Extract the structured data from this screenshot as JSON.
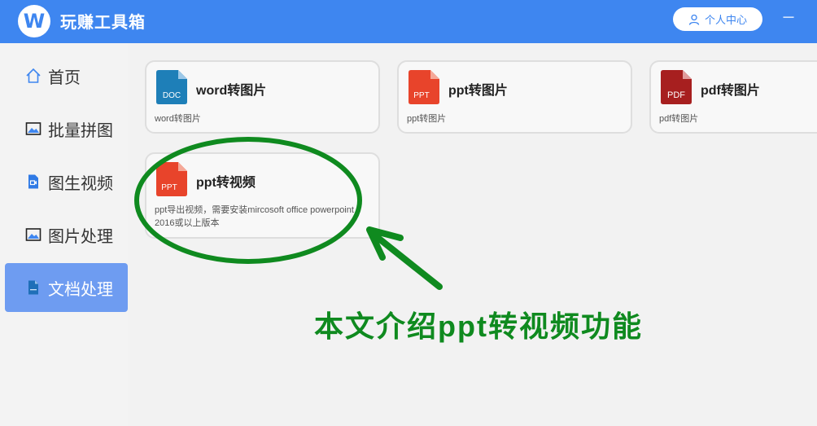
{
  "app": {
    "title": "玩赚工具箱",
    "logo_letter": "W"
  },
  "header": {
    "user_center_label": "个人中心",
    "minimize_label": "－"
  },
  "sidebar": {
    "items": [
      {
        "label": "首页",
        "icon": "home-icon",
        "active": false
      },
      {
        "label": "批量拼图",
        "icon": "image-icon",
        "active": false
      },
      {
        "label": "图生视频",
        "icon": "video-file-icon",
        "active": false
      },
      {
        "label": "图片处理",
        "icon": "image-icon",
        "active": false
      },
      {
        "label": "文档处理",
        "icon": "doc-file-icon",
        "active": true
      }
    ]
  },
  "cards": [
    {
      "title": "word转图片",
      "desc": "word转图片",
      "file_label": "DOC",
      "color": "#1e7fb8"
    },
    {
      "title": "ppt转图片",
      "desc": "ppt转图片",
      "file_label": "PPT",
      "color": "#e8442b"
    },
    {
      "title": "pdf转图片",
      "desc": "pdf转图片",
      "file_label": "PDF",
      "color": "#a71f1f"
    },
    {
      "title": "ppt转视频",
      "desc": "ppt导出视频，需要安装mircosoft office powerpoint 2016或以上版本",
      "file_label": "PPT",
      "color": "#e8442b"
    }
  ],
  "annotation": {
    "text": "本文介绍ppt转视频功能",
    "color": "#0f8a1f"
  },
  "colors": {
    "header": "#3e86f0",
    "sidebar_active": "#6e9cf1"
  }
}
